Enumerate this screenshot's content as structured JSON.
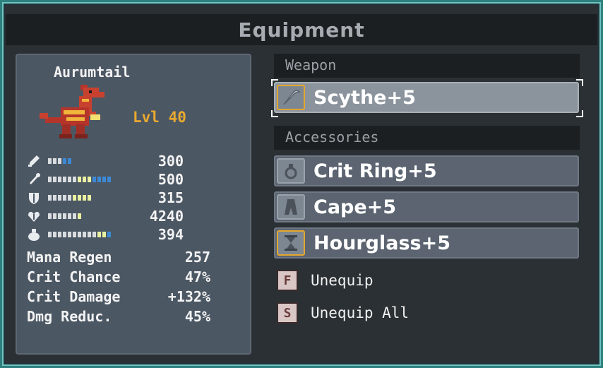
{
  "window": {
    "title": "Equipment"
  },
  "character": {
    "name": "Aurumtail",
    "level": "Lvl 40",
    "stats": [
      {
        "icon": "sword-icon",
        "value": "300",
        "bar": [
          "w",
          "w",
          "w",
          "b",
          "b"
        ]
      },
      {
        "icon": "staff-icon",
        "value": "500",
        "bar": [
          "w",
          "w",
          "w",
          "w",
          "w",
          "w",
          "y",
          "y",
          "y",
          "b",
          "b",
          "b",
          "b"
        ]
      },
      {
        "icon": "shield-icon",
        "value": "315",
        "bar": [
          "w",
          "w",
          "w",
          "w",
          "w",
          "y",
          "y",
          "y",
          "y"
        ]
      },
      {
        "icon": "heart-icon",
        "value": "4240",
        "bar": [
          "w",
          "w",
          "w",
          "w",
          "w",
          "w",
          "y"
        ]
      },
      {
        "icon": "potion-icon",
        "value": "394",
        "bar": [
          "w",
          "w",
          "w",
          "w",
          "w",
          "w",
          "w",
          "w",
          "w",
          "w",
          "y",
          "y",
          "b"
        ]
      }
    ],
    "derived": [
      {
        "label": "Mana Regen",
        "value": "257"
      },
      {
        "label": "Crit Chance",
        "value": "47%"
      },
      {
        "label": "Crit Damage",
        "value": "+132%"
      },
      {
        "label": "Dmg Reduc.",
        "value": "45%"
      }
    ]
  },
  "weapon": {
    "header": "Weapon",
    "item": {
      "name": "Scythe+5",
      "icon": "scythe-icon"
    }
  },
  "accessories": {
    "header": "Accessories",
    "items": [
      {
        "name": "Crit Ring+5",
        "icon": "ring-icon"
      },
      {
        "name": "Cape+5",
        "icon": "cape-icon"
      },
      {
        "name": "Hourglass+5",
        "icon": "hourglass-icon"
      }
    ]
  },
  "actions": [
    {
      "key": "F",
      "label": "Unequip"
    },
    {
      "key": "S",
      "label": "Unequip All"
    }
  ],
  "colors": {
    "accent_gold": "#e5a72d",
    "frame_teal": "#6fc7c3",
    "level": "#e9a92f"
  }
}
